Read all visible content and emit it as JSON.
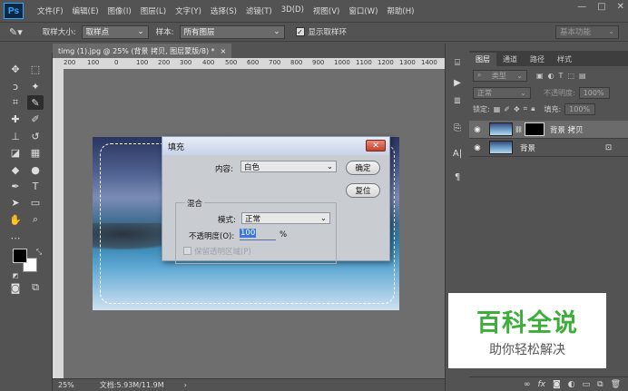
{
  "app": {
    "logo": "Ps",
    "workspace": "基本功能"
  },
  "menu": [
    "文件(F)",
    "编辑(E)",
    "图像(I)",
    "图层(L)",
    "文字(Y)",
    "选择(S)",
    "滤镜(T)",
    "3D(D)",
    "视图(V)",
    "窗口(W)",
    "帮助(H)"
  ],
  "window_controls": [
    "—",
    "□",
    "✕"
  ],
  "options_bar": {
    "sample_size_label": "取样大小:",
    "sample_size_value": "取样点",
    "sample_label": "样本:",
    "sample_value": "所有图层",
    "show_ring_label": "显示取样环",
    "show_ring_checked": true
  },
  "document": {
    "tab_title": "timg (1).jpg @ 25% (背景 拷贝, 图层蒙版/8) *",
    "tab_close": "×",
    "ruler_ticks": [
      "200",
      "100",
      "0",
      "100",
      "200",
      "300",
      "400",
      "500",
      "600",
      "700",
      "800",
      "900",
      "1000",
      "1100",
      "1200",
      "1300",
      "1400"
    ]
  },
  "status_bar": {
    "zoom": "25%",
    "doc_info": "文档:5.93M/11.9M",
    "arrow": "›"
  },
  "dialog": {
    "title": "填充",
    "close": "✕",
    "content_label": "内容:",
    "content_value": "白色",
    "ok_label": "确定",
    "reset_label": "复位",
    "blend_group_label": "混合",
    "mode_label": "模式:",
    "mode_value": "正常",
    "opacity_label": "不透明度(O):",
    "opacity_value": "100",
    "opacity_unit": "%",
    "preserve_label": "保留透明区域(P)"
  },
  "layers_panel": {
    "tabs": [
      "图层",
      "通道",
      "路径",
      "样式"
    ],
    "active_tab": "图层",
    "filter_placeholder": "类型",
    "blend_mode": "正常",
    "opacity_label": "不透明度:",
    "opacity_value": "100%",
    "lock_label": "锁定:",
    "fill_label": "填充:",
    "fill_value": "100%",
    "layers": [
      {
        "name": "背景 拷贝",
        "active": true,
        "has_mask": true
      },
      {
        "name": "背景",
        "active": false,
        "locked": true
      }
    ],
    "bottom_icons": [
      "link-icon",
      "fx-icon",
      "mask-icon",
      "adjustment-icon",
      "group-icon",
      "new-layer-icon",
      "trash-icon"
    ],
    "bottom_glyphs": {
      "link": "∞",
      "fx": "fx"
    }
  },
  "watermark": {
    "title": "百科全说",
    "subtitle": "助你轻松解决"
  }
}
